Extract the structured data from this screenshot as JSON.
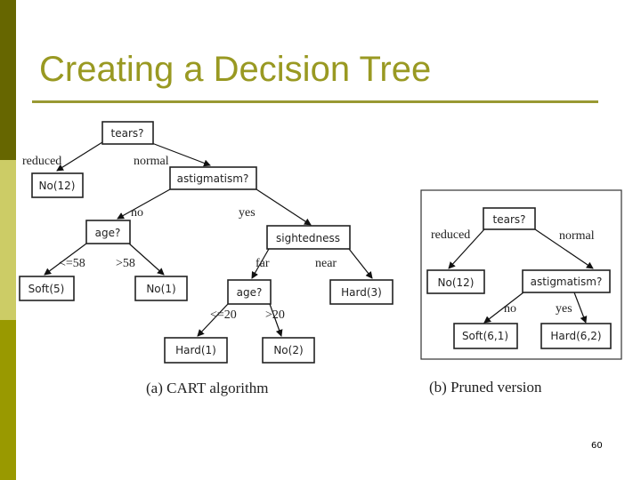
{
  "slide": {
    "title": "Creating a Decision Tree",
    "page_number": "60",
    "colors": {
      "sidebar_top": "#666600",
      "sidebar_middle": "#CCCC66",
      "sidebar_bottom": "#999900",
      "title": "#999922",
      "rule": "#999933"
    }
  },
  "figure": {
    "cart": {
      "caption": "(a) CART algorithm",
      "nodes": {
        "tears": "tears?",
        "no12": "No(12)",
        "astig": "astigmatism?",
        "age1": "age?",
        "sight": "sightedness",
        "soft5": "Soft(5)",
        "no1": "No(1)",
        "age2": "age?",
        "hard3": "Hard(3)",
        "hard1": "Hard(1)",
        "no2": "No(2)"
      },
      "edges": {
        "reduced": "reduced",
        "normal": "normal",
        "no": "no",
        "yes": "yes",
        "le58": "<=58",
        "gt58": ">58",
        "far": "far",
        "near": "near",
        "le20": "<=20",
        "gt20": ">20"
      }
    },
    "pruned": {
      "caption": "(b)  Pruned version",
      "nodes": {
        "tears": "tears?",
        "no12": "No(12)",
        "astig": "astigmatism?",
        "soft61": "Soft(6,1)",
        "hard62": "Hard(6,2)"
      },
      "edges": {
        "reduced": "reduced",
        "normal": "normal",
        "no": "no",
        "yes": "yes"
      }
    }
  }
}
